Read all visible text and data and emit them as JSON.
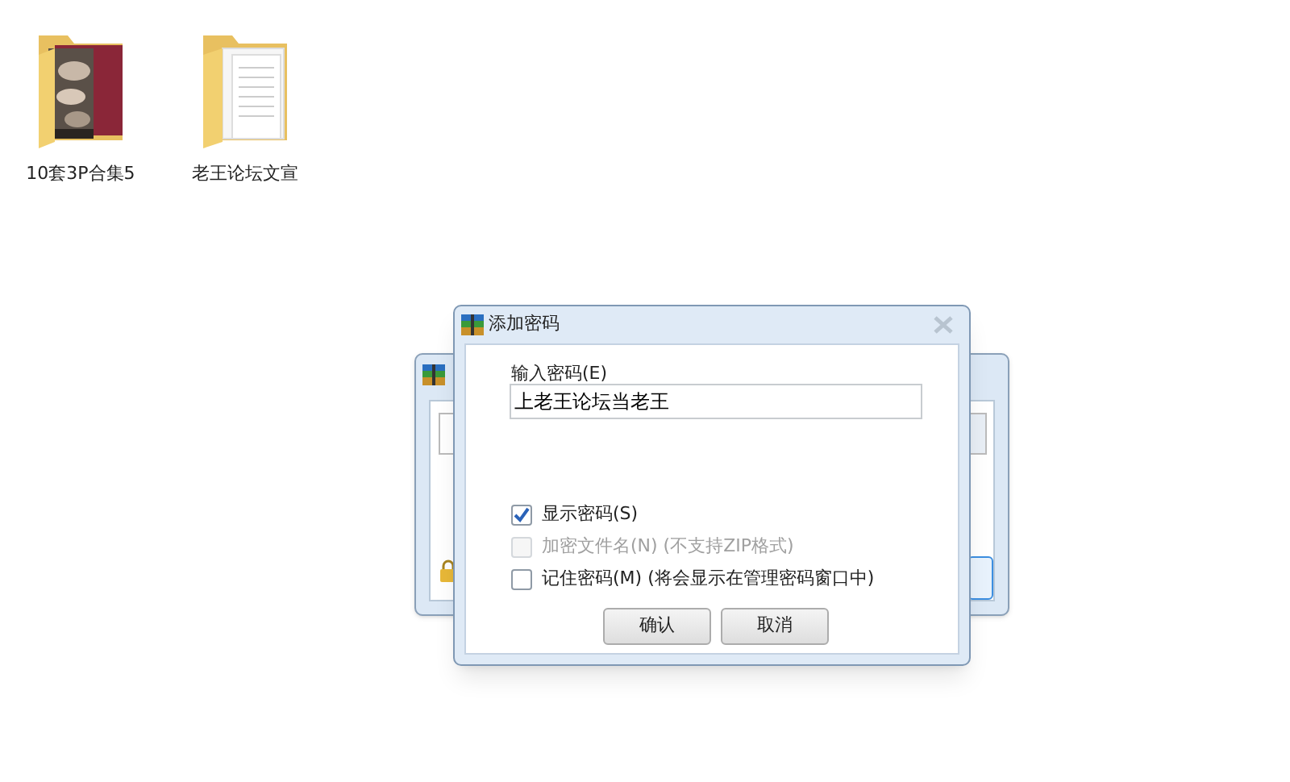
{
  "desktop_icons": [
    {
      "label": "10套3P合集5",
      "kind": "picture"
    },
    {
      "label": "老王论坛文宣",
      "kind": "documents"
    }
  ],
  "dialog": {
    "title": "添加密码",
    "password_label": "输入密码(E)",
    "password_value": "上老王论坛当老王",
    "options": [
      {
        "label": "显示密码(S)",
        "checked": true,
        "disabled": false
      },
      {
        "label": "加密文件名(N) (不支持ZIP格式)",
        "checked": false,
        "disabled": true
      },
      {
        "label": "记住密码(M) (将会显示在管理密码窗口中)",
        "checked": false,
        "disabled": false
      }
    ],
    "buttons": [
      "确认",
      "取消"
    ]
  }
}
